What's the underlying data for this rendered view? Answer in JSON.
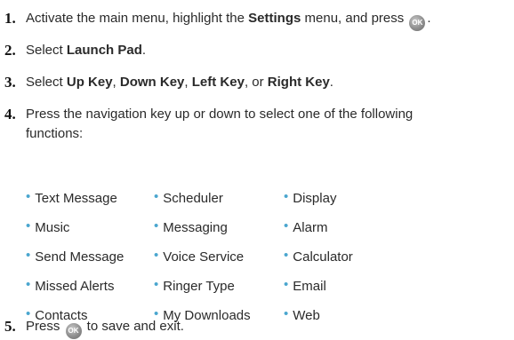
{
  "steps": [
    {
      "number": "1.",
      "parts": [
        "Activate the main menu, highlight the ",
        "Settings",
        " menu, and press ",
        "."
      ],
      "ok_icon": "ok-button-icon"
    },
    {
      "number": "2.",
      "parts": [
        "Select ",
        "Launch Pad",
        "."
      ]
    },
    {
      "number": "3.",
      "parts": [
        "Select ",
        "Up Key",
        ", ",
        "Down Key",
        ", ",
        "Left Key",
        ", or ",
        "Right Key",
        "."
      ]
    },
    {
      "number": "4.",
      "line1": "Press the navigation key up or down to select one of the following",
      "line2": "functions:"
    },
    {
      "number": "5.",
      "parts": [
        "Press ",
        " to save and exit."
      ],
      "ok_icon": "ok-button-icon"
    }
  ],
  "ok_label": "OK",
  "functions": [
    "Text Message",
    "Scheduler",
    "Display",
    "Music",
    "Messaging",
    "Alarm",
    "Send Message",
    "Voice Service",
    "Calculator",
    "Missed Alerts",
    "Ringer Type",
    "Email",
    "Contacts",
    "My Downloads",
    "Web"
  ],
  "bullet_color": "#4aa6cf",
  "bullet_glyph": "•"
}
